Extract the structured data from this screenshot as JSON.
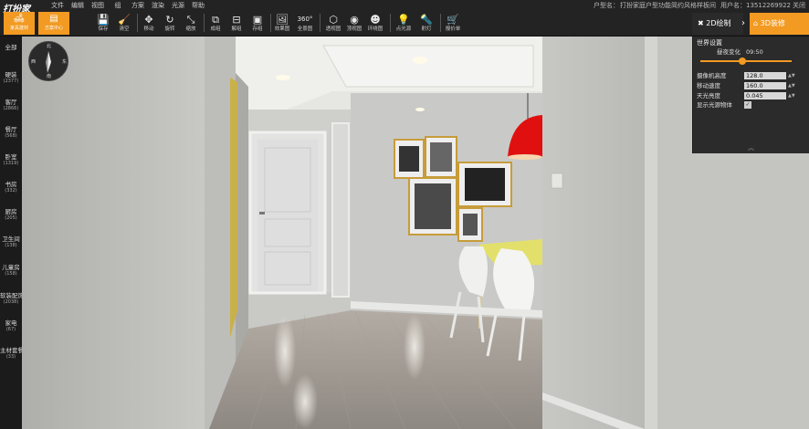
{
  "app": {
    "logo": "打扮家",
    "info_label": "户型名：",
    "project_name": "打扮家庭户型功能简约风格样板间",
    "user": "用户名：13512269922",
    "close_label": "关闭"
  },
  "menu": [
    "文件",
    "编辑",
    "视图",
    "组",
    "方案",
    "渲染",
    "光源",
    "帮助"
  ],
  "primary": [
    {
      "label": "家具建材",
      "icon": "sofa-icon"
    },
    {
      "label": "方案中心",
      "icon": "document-icon"
    }
  ],
  "toolbar": [
    {
      "label": "保存",
      "glyph": "💾",
      "icon": "save-icon"
    },
    {
      "label": "清空",
      "glyph": "🧹",
      "icon": "broom-icon"
    },
    {
      "label": "移动",
      "glyph": "✥",
      "icon": "move-icon"
    },
    {
      "label": "旋转",
      "glyph": "↻",
      "icon": "rotate-icon"
    },
    {
      "label": "缩放",
      "glyph": "⤡",
      "icon": "scale-icon"
    },
    {
      "label": "成组",
      "glyph": "⧉",
      "icon": "group-icon"
    },
    {
      "label": "解组",
      "glyph": "⊟",
      "icon": "ungroup-icon"
    },
    {
      "label": "存组",
      "glyph": "▣",
      "icon": "save-group-icon"
    },
    {
      "label": "效果图",
      "glyph": "🖼",
      "icon": "render-image-icon"
    },
    {
      "label": "全景图",
      "glyph": "360°",
      "icon": "panorama-icon"
    },
    {
      "label": "透视图",
      "glyph": "⬡",
      "icon": "perspective-icon"
    },
    {
      "label": "顶视图",
      "glyph": "◉",
      "icon": "top-view-icon"
    },
    {
      "label": "环绕图",
      "glyph": "☻",
      "icon": "orbit-view-icon"
    },
    {
      "label": "点光源",
      "glyph": "💡",
      "icon": "point-light-icon"
    },
    {
      "label": "射灯",
      "glyph": "🔦",
      "icon": "spotlight-icon"
    },
    {
      "label": "报价单",
      "glyph": "🛒",
      "icon": "quote-icon"
    }
  ],
  "modes": {
    "mode_2d": "2D绘制",
    "mode_3d": "3D装修",
    "icon_2d": "✖",
    "icon_3d": "⌂"
  },
  "categories": [
    {
      "name": "全部",
      "count": ""
    },
    {
      "name": "硬装",
      "count": "(2377)"
    },
    {
      "name": "客厅",
      "count": "(2866)"
    },
    {
      "name": "餐厅",
      "count": "(568)"
    },
    {
      "name": "卧室",
      "count": "(1319)"
    },
    {
      "name": "书房",
      "count": "(332)"
    },
    {
      "name": "厨房",
      "count": "(205)"
    },
    {
      "name": "卫生间",
      "count": "(138)"
    },
    {
      "name": "儿童房",
      "count": "(158)"
    },
    {
      "name": "软装配饰",
      "count": "(2038)"
    },
    {
      "name": "家电",
      "count": "(67)"
    },
    {
      "name": "主材套餐",
      "count": "(33)"
    }
  ],
  "compass": {
    "n": "北",
    "s": "南",
    "e": "东",
    "w": "西"
  },
  "panel": {
    "title": "世界设置",
    "day_night_label": "昼夜变化",
    "time": "09:50",
    "day_night_level": 0.46,
    "rows": [
      {
        "label": "摄像机高度",
        "value": "128.0"
      },
      {
        "label": "移动速度",
        "value": "160.0"
      },
      {
        "label": "天光亮度",
        "value": "0.045"
      }
    ],
    "show_light_label": "显示光源物体",
    "show_light_checked": "✓",
    "spin_glyph": "▲▼",
    "collapse_glyph": "︽"
  },
  "colors": {
    "accent": "#f29a22",
    "toolbar_bg": "#232323",
    "pendant": "#e01010"
  }
}
